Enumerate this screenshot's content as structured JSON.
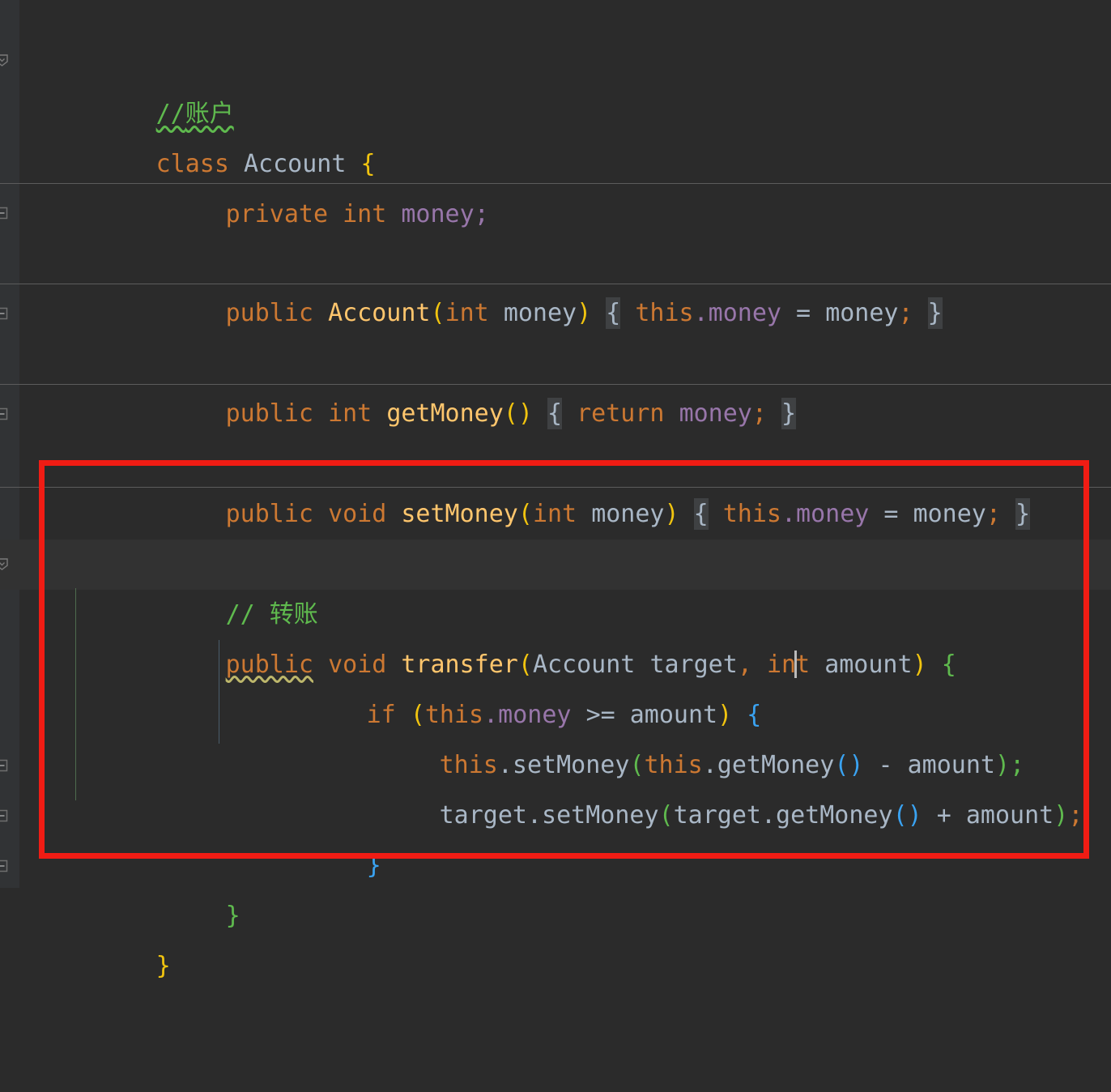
{
  "editor": {
    "language": "java",
    "theme": "darcula",
    "background": "#2b2b2b",
    "gutter_background": "#313335",
    "current_line_background": "#323232",
    "annotation_color": "#f01c14"
  },
  "palette": {
    "keyword": "#cc7832",
    "identifier": "#a9b7c6",
    "method_declaration": "#ffc66d",
    "field": "#9876aa",
    "comment": "#5fba4e",
    "bracket_yellow": "#f1c40f",
    "bracket_green": "#5fba4e",
    "bracket_blue": "#3aa3f2",
    "folded_chip_bg": "#3f4143",
    "warning_squiggle": "#bdb76b",
    "info_squiggle": "#5fba4e"
  },
  "code": {
    "line1": {
      "comment_slashes": "//",
      "comment_text": "账户"
    },
    "line2": {
      "kw_class": "class",
      "name": "Account",
      "brace": "{"
    },
    "line3": {
      "kw_private": "private",
      "kw_int": "int",
      "field": "money",
      "semi": ";"
    },
    "line4": {
      "kw_public": "public",
      "name": "Account",
      "paren_open": "(",
      "kw_int": "int",
      "param": "money",
      "paren_close": ")",
      "fold_open": "{",
      "body_this": "this",
      "body_dot_field": ".money",
      "body_eq": " = ",
      "body_value": "money",
      "body_semi": ";",
      "fold_close": "}"
    },
    "line5": {
      "kw_public": "public",
      "kw_int": "int",
      "name": "getMoney",
      "parens": "()",
      "fold_open": "{",
      "kw_return": "return",
      "value": "money",
      "semi": ";",
      "fold_close": "}"
    },
    "line6": {
      "kw_public": "public",
      "kw_void": "void",
      "name": "setMoney",
      "paren_open": "(",
      "kw_int": "int",
      "param": "money",
      "paren_close": ")",
      "fold_open": "{",
      "body_this": "this",
      "body_dot_field": ".money",
      "body_eq": " = ",
      "body_value": "money",
      "body_semi": ";",
      "fold_close": "}"
    },
    "line7": {
      "comment_slashes": "//",
      "comment_text": "转账"
    },
    "line8": {
      "kw_public": "public",
      "kw_void": "void",
      "name": "transfer",
      "paren_open": "(",
      "type1": "Account",
      "param1": "target",
      "comma": ",",
      "kw_int_a": "in",
      "kw_int_b": "t",
      "param2": "amount",
      "paren_close": ")",
      "brace": "{"
    },
    "line9": {
      "kw_if": "if",
      "paren_open": "(",
      "this": "this",
      "dot_field": ".money",
      "op": ">=",
      "operand": "amount",
      "paren_close": ")",
      "brace": "{"
    },
    "line10": {
      "recv": "this",
      "dot_call": ".setMoney",
      "paren_open": "(",
      "arg_recv": "this",
      "arg_call": ".getMoney",
      "arg_parens": "()",
      "op": "-",
      "operand": "amount",
      "paren_close": ")",
      "semi": ";"
    },
    "line11": {
      "recv": "target",
      "dot_call": ".setMoney",
      "paren_open": "(",
      "arg_recv": "target",
      "arg_call": ".getMoney",
      "arg_parens": "()",
      "op": "+",
      "operand": "amount",
      "paren_close": ")",
      "semi": ";"
    },
    "line12": {
      "brace": "}"
    },
    "line13": {
      "brace": "}"
    },
    "line14": {
      "brace": "}"
    }
  }
}
